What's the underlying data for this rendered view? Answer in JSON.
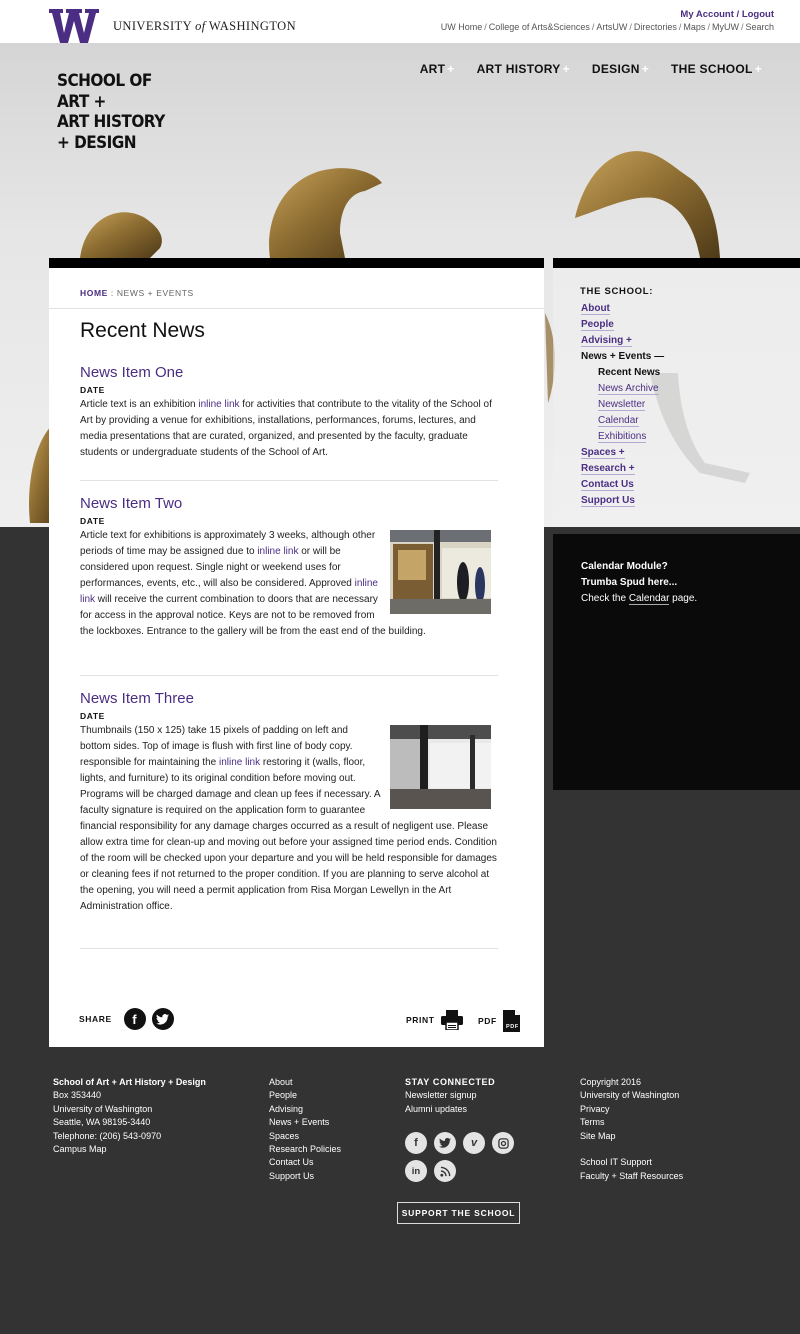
{
  "topbar": {
    "brand_university": "UNIVERSITY",
    "brand_of": "of",
    "brand_washington": "WASHINGTON",
    "account_link": "My Account",
    "logout_link": "Logout",
    "utility_links": [
      "UW Home",
      "College of Arts&Sciences",
      "ArtsUW",
      "Directories",
      "Maps",
      "MyUW",
      "Search"
    ]
  },
  "logo": {
    "line1": "SCHOOL OF",
    "line2": "ART +",
    "line3": "ART HISTORY",
    "line4": "+ DESIGN"
  },
  "main_nav": [
    {
      "label": "ART",
      "icon": "plus-icon"
    },
    {
      "label": "ART HISTORY",
      "icon": "plus-icon"
    },
    {
      "label": "DESIGN",
      "icon": "plus-icon"
    },
    {
      "label": "THE SCHOOL",
      "icon": "plus-icon"
    }
  ],
  "breadcrumb": {
    "home": "HOME",
    "separator": ":",
    "current": "NEWS + EVENTS"
  },
  "page_title": "Recent News",
  "news": [
    {
      "title": "News Item One",
      "date": "DATE",
      "text_before": "Article text is an exhibition ",
      "link": "inline link",
      "text_after": " for activities that contribute to the vitality of the School of Art by providing a venue for exhibitions, installations, performances, forums, lectures, and media presentations that are curated, organized, and presented by the faculty, graduate students or undergraduate students of the School of Art."
    },
    {
      "title": "News Item Two",
      "date": "DATE",
      "text_a": "Article text for exhibitions is approximately 3 weeks, although other periods of time may be assigned due to ",
      "link_a": "inline link",
      "text_b": " or will be considered upon request. Single night or weekend uses for performances, events, etc., will also be considered. Approved ",
      "link_b": "inline link",
      "text_c": " will receive the current combination to doors that are necessary for access in the approval notice. Keys are not to be removed from the lockboxes. Entrance to the gallery will be from the east end of the building."
    },
    {
      "title": "News Item Three",
      "date": "DATE",
      "text_before": "Thumbnails (150 x 125) take 15 pixels of padding on left and bottom sides. Top of image is flush with first line of body copy. responsible for maintaining the ",
      "link": "inline link",
      "text_after": " restoring it (walls, floor, lights, and furniture) to its original condition before moving out. Programs will be charged damage and clean up fees if necessary. A faculty signature is required on the application form to guarantee financial responsibility for any damage charges occurred as a result of negligent use. Please allow extra time for clean-up and moving out before your assigned time period ends. Condition of the room will be checked upon your departure and you will be held responsible for damages or cleaning fees if not returned to the proper condition. If you are planning to serve alcohol at the opening, you will need a permit application from Risa Morgan Lewellyn in the Art Administration office."
    }
  ],
  "share": {
    "label": "SHARE",
    "icons": [
      "facebook-icon",
      "twitter-icon"
    ]
  },
  "print_label": "PRINT",
  "pdf_label": "PDF",
  "sidenav": {
    "heading": "THE SCHOOL:",
    "items": [
      {
        "label": "About"
      },
      {
        "label": "People"
      },
      {
        "label": "Advising +"
      },
      {
        "label": "News + Events —"
      },
      {
        "label": "Recent News"
      },
      {
        "label": "News Archive"
      },
      {
        "label": "Newsletter"
      },
      {
        "label": "Calendar"
      },
      {
        "label": "Exhibitions"
      },
      {
        "label": "Spaces +"
      },
      {
        "label": "Research +"
      },
      {
        "label": "Contact Us"
      },
      {
        "label": "Support Us"
      }
    ]
  },
  "calendar": {
    "line1": "Calendar Module?",
    "line2": "Trumba Spud here...",
    "line3_before": "Check the ",
    "line3_link": "Calendar",
    "line3_after": " page."
  },
  "footer": {
    "address": {
      "name": "School of Art + Art History + Design",
      "lines": [
        "Box 353440",
        "University of Washington",
        "Seattle, WA 98195-3440",
        "Telephone: (206) 543-0970",
        "Campus Map"
      ]
    },
    "links": [
      "About",
      "People",
      "Advising",
      "News + Events",
      "Spaces",
      "Research Policies",
      "Contact Us",
      "Support Us"
    ],
    "connected": {
      "title": "STAY CONNECTED",
      "links": [
        "Newsletter signup",
        "Alumni updates"
      ],
      "social_icons": [
        "facebook-icon",
        "twitter-icon",
        "vimeo-icon",
        "instagram-icon",
        "linkedin-icon",
        "rss-icon"
      ]
    },
    "legal": {
      "lines": [
        "Copyright 2016",
        "University of Washington",
        "Privacy",
        "Terms",
        "Site Map"
      ],
      "lines2": [
        "School IT Support",
        "Faculty + Staff Resources"
      ]
    },
    "support_button": "SUPPORT THE SCHOOL"
  },
  "colors": {
    "uw_purple": "#4b2e83",
    "footer_bg": "#333333",
    "calendar_bg": "#0a0a0a"
  }
}
